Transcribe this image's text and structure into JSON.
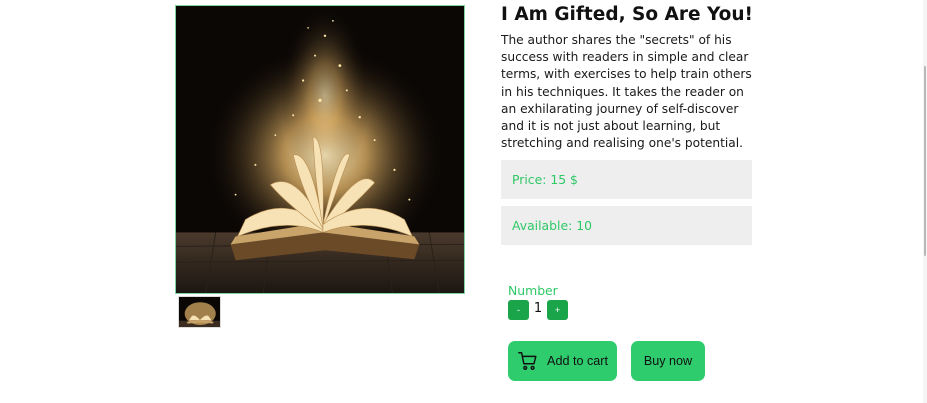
{
  "product": {
    "title": "I Am Gifted, So Are You!",
    "description": "The author shares the \"secrets\" of his success with readers in simple and clear terms, with exercises to help train others in his techniques. It takes the reader on an exhilarating journey of self-discover and it is not just about learning, but stretching and realising one's potential.",
    "price": "Price: 15 $",
    "available": "Available: 10",
    "image_icon": "glowing-open-book-image"
  },
  "purchase": {
    "number_label": "Number",
    "minus_label": "-",
    "plus_label": "+",
    "quantity": "1",
    "add_to_cart_label": "Add to cart",
    "buy_now_label": "Buy now",
    "cart_icon": "cart-icon"
  },
  "colors": {
    "accent_green": "#2ecc6d",
    "stepper_green": "#1aa54a",
    "info_text_green": "#2ec866",
    "info_box_bg": "#eeeeee"
  }
}
